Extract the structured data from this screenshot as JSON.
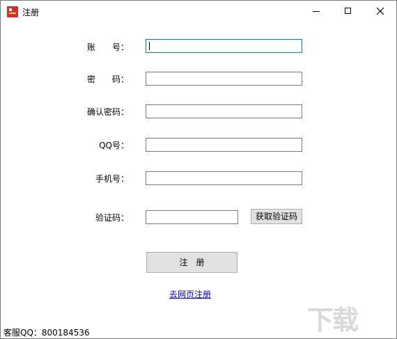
{
  "window": {
    "title": "注册"
  },
  "form": {
    "account_label": "账　　号：",
    "password_label": "密　　码：",
    "confirm_label": "确认密码：",
    "qq_label": "QQ号：",
    "phone_label": "手机号：",
    "code_label": "验证码："
  },
  "buttons": {
    "get_code": "获取验证码",
    "register": "注　册"
  },
  "links": {
    "web_register": "去网页注册"
  },
  "footer": {
    "support": "客服QQ：800184536"
  },
  "watermark": {
    "mark": "下载"
  }
}
